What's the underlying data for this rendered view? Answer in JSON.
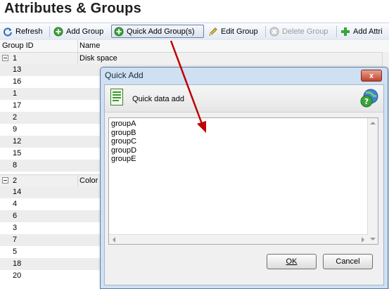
{
  "page": {
    "title": "Attributes & Groups"
  },
  "toolbar": {
    "refresh": "Refresh",
    "add_group": "Add Group",
    "quick_add_group": "Quick Add Group(s)",
    "edit_group": "Edit Group",
    "delete_group": "Delete Group",
    "add_attr": "Add Attri"
  },
  "grid": {
    "columns": [
      "Group ID",
      "Name"
    ],
    "groups": [
      {
        "id": "1",
        "name": "Disk space",
        "children": [
          "13",
          "16",
          "1",
          "17",
          "2",
          "9",
          "12",
          "15",
          "8"
        ]
      },
      {
        "id": "2",
        "name": "Color",
        "children": [
          "14",
          "4",
          "6",
          "3",
          "7",
          "5",
          "18",
          "20"
        ]
      }
    ]
  },
  "dialog": {
    "title": "Quick Add",
    "close": "x",
    "header_label": "Quick data add",
    "lines": [
      "groupA",
      "groupB",
      "groupC",
      "groupD",
      "groupE"
    ],
    "ok_label": "OK",
    "cancel_label": "Cancel"
  },
  "colors": {
    "arrow": "#c00000",
    "dialog_frame": "#cfe0f3"
  },
  "icons": [
    "refresh-icon",
    "add-icon",
    "edit-icon",
    "delete-icon",
    "document-icon",
    "help-icon"
  ]
}
